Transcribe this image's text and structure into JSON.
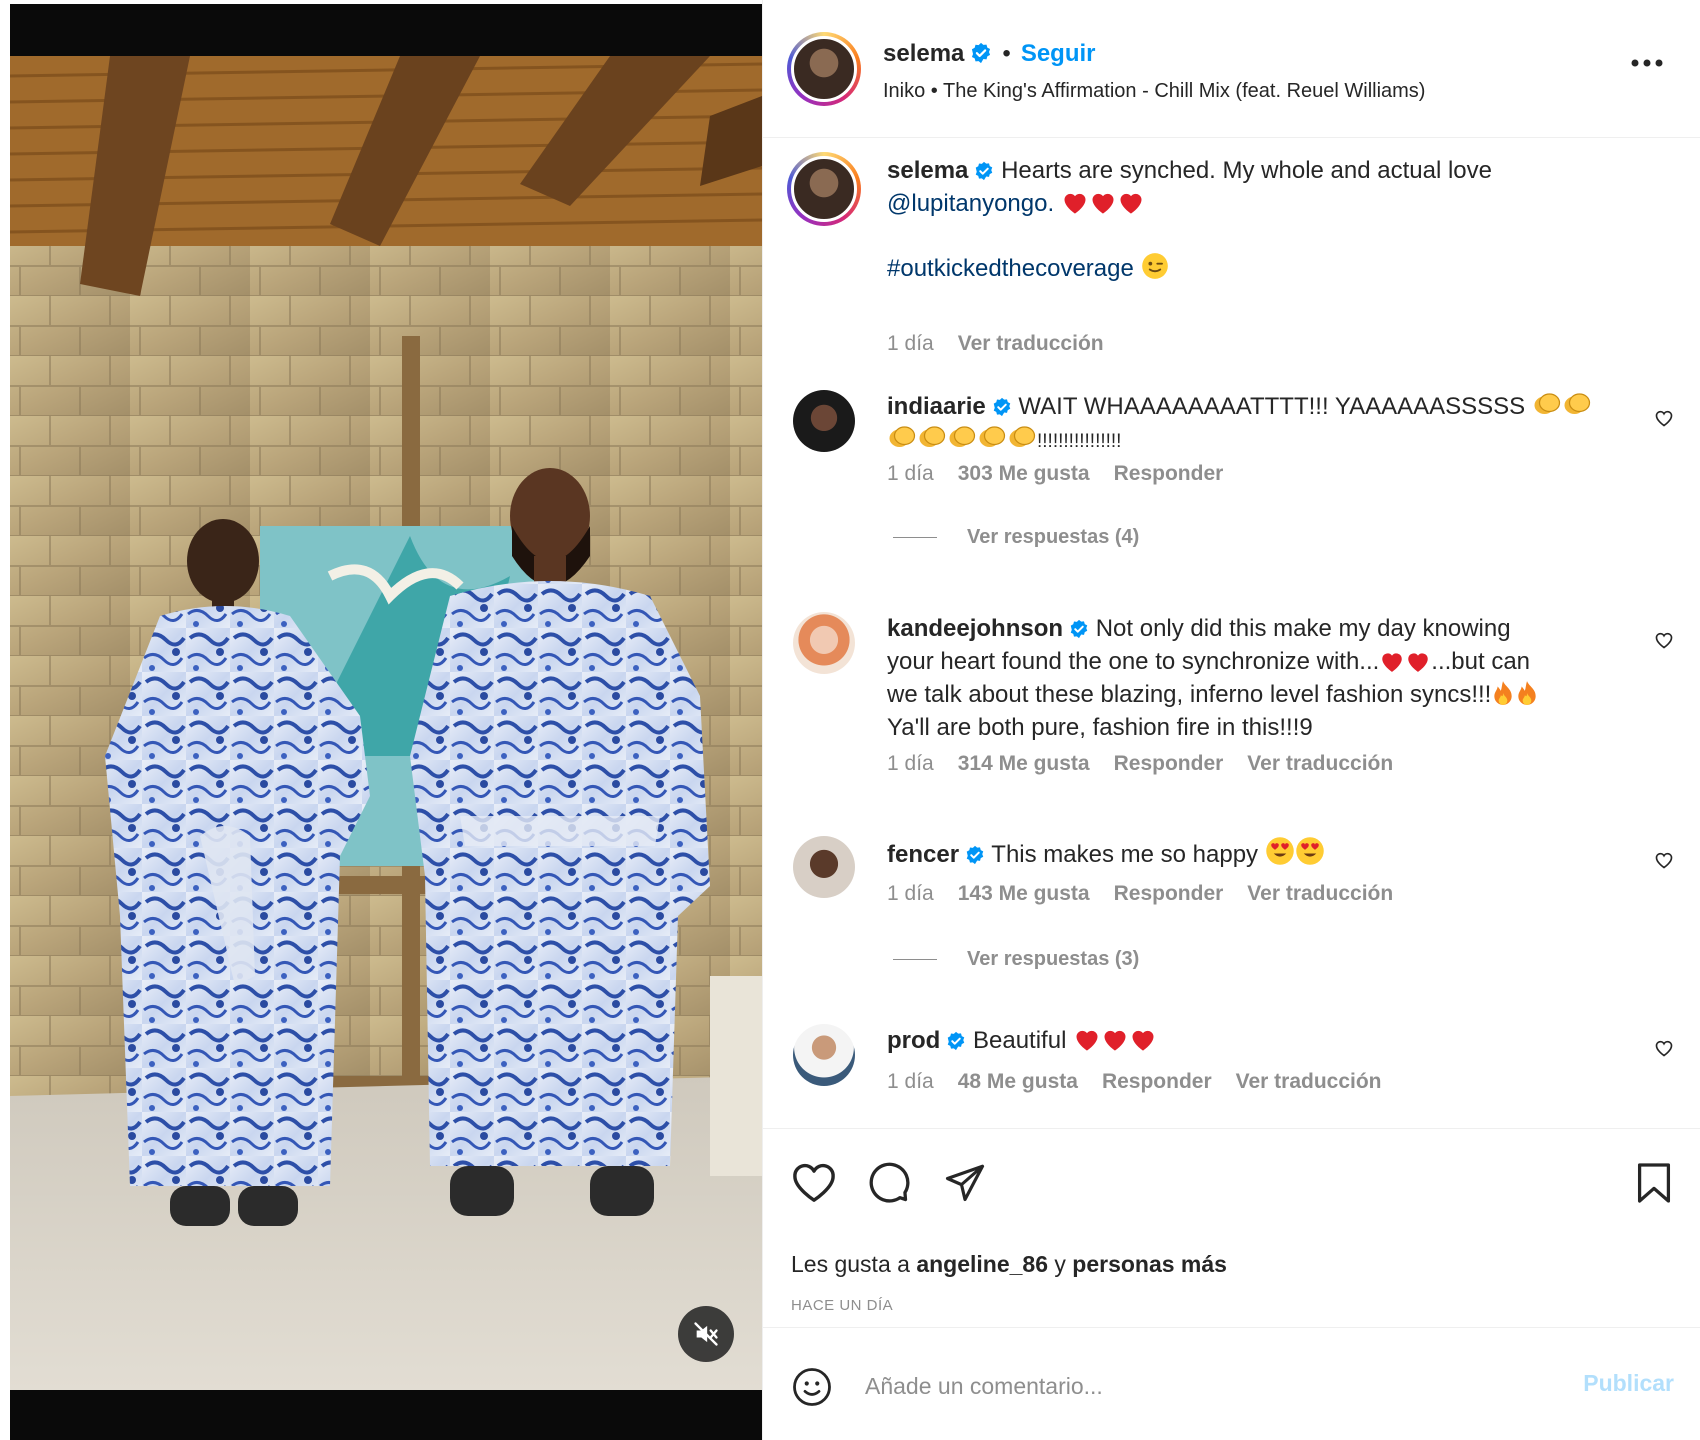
{
  "colors": {
    "accent_blue": "#0095f6",
    "link_blue": "#00376b",
    "verified_blue": "#0095f6",
    "heart_red": "#ed4956",
    "meta_gray": "#8e8e8e",
    "publish_disabled": "#b2dffc"
  },
  "media": {
    "mute_icon": "speaker-muted-icon"
  },
  "header": {
    "username": "selema",
    "separator": "•",
    "follow_label": "Seguir",
    "audio": "Iniko • The King's Affirmation - Chill Mix (feat. Reuel Williams)",
    "more_icon": "more-horizontal-icon"
  },
  "caption": {
    "username": "selema",
    "text": "Hearts are synched. My whole and actual love",
    "mention": "@lupitanyongo.",
    "hashtag": "#outkickedthecoverage",
    "time": "1 día",
    "translate": "Ver traducción"
  },
  "comments": [
    {
      "username": "indiaarie",
      "text_1": "WAIT WHAAAAAAAATTTT!!! YAAAAAASSSSS",
      "text_2": "!!!!!!!!!!!!!!!!",
      "time": "1 día",
      "likes": "303 Me gusta",
      "reply": "Responder",
      "view_replies": "Ver respuestas (4)"
    },
    {
      "username": "kandeejohnson",
      "text_1": "Not only did this make my day knowing",
      "text_2": "your heart found the one to synchronize with...",
      "text_2b": "...but can",
      "text_3": "we talk about these blazing, inferno level fashion syncs!!!",
      "text_4": "Ya'll are both pure, fashion fire in this!!!9",
      "time": "1 día",
      "likes": "314 Me gusta",
      "reply": "Responder",
      "translate": "Ver traducción"
    },
    {
      "username": "fencer",
      "text": "This makes me so happy",
      "time": "1 día",
      "likes": "143 Me gusta",
      "reply": "Responder",
      "translate": "Ver traducción",
      "view_replies": "Ver respuestas (3)"
    },
    {
      "username": "prod",
      "text": "Beautiful",
      "time": "1 día",
      "likes": "48 Me gusta",
      "reply": "Responder",
      "translate": "Ver traducción"
    }
  ],
  "actions": {
    "like_icon": "heart-icon",
    "comment_icon": "comment-icon",
    "share_icon": "send-icon",
    "save_icon": "bookmark-icon",
    "likes_prefix": "Les gusta a",
    "likes_user": "angeline_86",
    "likes_joiner": "y",
    "likes_others": "personas más",
    "timestamp": "HACE UN DÍA"
  },
  "comment_box": {
    "emoji_icon": "smiley-icon",
    "placeholder": "Añade un comentario...",
    "publish_label": "Publicar"
  }
}
